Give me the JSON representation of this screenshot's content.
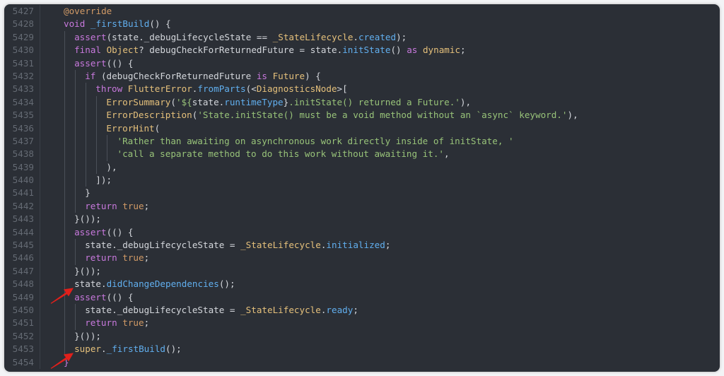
{
  "editor": {
    "lines": [
      {
        "num": "5427",
        "indent": 0,
        "tokens": [
          {
            "t": "@override",
            "c": "a"
          }
        ]
      },
      {
        "num": "5428",
        "indent": 0,
        "tokens": [
          {
            "t": "void ",
            "c": "k"
          },
          {
            "t": "_firstBuild",
            "c": "f"
          },
          {
            "t": "() {",
            "c": "p"
          }
        ]
      },
      {
        "num": "5429",
        "indent": 1,
        "tokens": [
          {
            "t": "assert",
            "c": "k"
          },
          {
            "t": "(state.",
            "c": "p"
          },
          {
            "t": "_debugLifecycleState",
            "c": "p"
          },
          {
            "t": " == ",
            "c": "p"
          },
          {
            "t": "_StateLifecycle",
            "c": "y"
          },
          {
            "t": ".",
            "c": "p"
          },
          {
            "t": "created",
            "c": "f"
          },
          {
            "t": ");",
            "c": "p"
          }
        ]
      },
      {
        "num": "5430",
        "indent": 1,
        "tokens": [
          {
            "t": "final ",
            "c": "k"
          },
          {
            "t": "Object",
            "c": "y"
          },
          {
            "t": "? debugCheckForReturnedFuture = state.",
            "c": "p"
          },
          {
            "t": "initState",
            "c": "f"
          },
          {
            "t": "() ",
            "c": "p"
          },
          {
            "t": "as ",
            "c": "k"
          },
          {
            "t": "dynamic",
            "c": "y"
          },
          {
            "t": ";",
            "c": "p"
          }
        ]
      },
      {
        "num": "5431",
        "indent": 1,
        "tokens": [
          {
            "t": "assert",
            "c": "k"
          },
          {
            "t": "(() {",
            "c": "p"
          }
        ]
      },
      {
        "num": "5432",
        "indent": 2,
        "tokens": [
          {
            "t": "if ",
            "c": "k"
          },
          {
            "t": "(debugCheckForReturnedFuture ",
            "c": "p"
          },
          {
            "t": "is ",
            "c": "k"
          },
          {
            "t": "Future",
            "c": "y"
          },
          {
            "t": ") {",
            "c": "p"
          }
        ]
      },
      {
        "num": "5433",
        "indent": 3,
        "tokens": [
          {
            "t": "throw ",
            "c": "k"
          },
          {
            "t": "FlutterError",
            "c": "y"
          },
          {
            "t": ".",
            "c": "p"
          },
          {
            "t": "fromParts",
            "c": "f"
          },
          {
            "t": "(<",
            "c": "p"
          },
          {
            "t": "DiagnosticsNode",
            "c": "y"
          },
          {
            "t": ">[",
            "c": "p"
          }
        ]
      },
      {
        "num": "5434",
        "indent": 4,
        "tokens": [
          {
            "t": "ErrorSummary",
            "c": "y"
          },
          {
            "t": "(",
            "c": "p"
          },
          {
            "t": "'${",
            "c": "s"
          },
          {
            "t": "state.",
            "c": "p"
          },
          {
            "t": "runtimeType",
            "c": "f"
          },
          {
            "t": "}",
            "c": "p"
          },
          {
            "t": ".initState() returned a Future.'",
            "c": "s"
          },
          {
            "t": "),",
            "c": "p"
          }
        ]
      },
      {
        "num": "5435",
        "indent": 4,
        "tokens": [
          {
            "t": "ErrorDescription",
            "c": "y"
          },
          {
            "t": "(",
            "c": "p"
          },
          {
            "t": "'State.initState() must be a void method without an `async` keyword.'",
            "c": "s"
          },
          {
            "t": "),",
            "c": "p"
          }
        ]
      },
      {
        "num": "5436",
        "indent": 4,
        "tokens": [
          {
            "t": "ErrorHint",
            "c": "y"
          },
          {
            "t": "(",
            "c": "p"
          }
        ]
      },
      {
        "num": "5437",
        "indent": 5,
        "tokens": [
          {
            "t": "'Rather than awaiting on asynchronous work directly inside of initState, '",
            "c": "s"
          }
        ]
      },
      {
        "num": "5438",
        "indent": 5,
        "tokens": [
          {
            "t": "'call a separate method to do this work without awaiting it.'",
            "c": "s"
          },
          {
            "t": ",",
            "c": "p"
          }
        ]
      },
      {
        "num": "5439",
        "indent": 4,
        "tokens": [
          {
            "t": "),",
            "c": "p"
          }
        ]
      },
      {
        "num": "5440",
        "indent": 3,
        "tokens": [
          {
            "t": "]);",
            "c": "p"
          }
        ]
      },
      {
        "num": "5441",
        "indent": 2,
        "tokens": [
          {
            "t": "}",
            "c": "p"
          }
        ]
      },
      {
        "num": "5442",
        "indent": 2,
        "tokens": [
          {
            "t": "return ",
            "c": "k"
          },
          {
            "t": "true",
            "c": "a"
          },
          {
            "t": ";",
            "c": "p"
          }
        ]
      },
      {
        "num": "5443",
        "indent": 1,
        "tokens": [
          {
            "t": "}());",
            "c": "p"
          }
        ]
      },
      {
        "num": "5444",
        "indent": 1,
        "tokens": [
          {
            "t": "assert",
            "c": "k"
          },
          {
            "t": "(() {",
            "c": "p"
          }
        ]
      },
      {
        "num": "5445",
        "indent": 2,
        "tokens": [
          {
            "t": "state.",
            "c": "p"
          },
          {
            "t": "_debugLifecycleState",
            "c": "p"
          },
          {
            "t": " = ",
            "c": "p"
          },
          {
            "t": "_StateLifecycle",
            "c": "y"
          },
          {
            "t": ".",
            "c": "p"
          },
          {
            "t": "initialized",
            "c": "f"
          },
          {
            "t": ";",
            "c": "p"
          }
        ]
      },
      {
        "num": "5446",
        "indent": 2,
        "tokens": [
          {
            "t": "return ",
            "c": "k"
          },
          {
            "t": "true",
            "c": "a"
          },
          {
            "t": ";",
            "c": "p"
          }
        ]
      },
      {
        "num": "5447",
        "indent": 1,
        "tokens": [
          {
            "t": "}());",
            "c": "p"
          }
        ]
      },
      {
        "num": "5448",
        "indent": 1,
        "tokens": [
          {
            "t": "state.",
            "c": "p"
          },
          {
            "t": "didChangeDependencies",
            "c": "f"
          },
          {
            "t": "();",
            "c": "p"
          }
        ]
      },
      {
        "num": "5449",
        "indent": 1,
        "tokens": [
          {
            "t": "assert",
            "c": "k"
          },
          {
            "t": "(() {",
            "c": "p"
          }
        ]
      },
      {
        "num": "5450",
        "indent": 2,
        "tokens": [
          {
            "t": "state.",
            "c": "p"
          },
          {
            "t": "_debugLifecycleState",
            "c": "p"
          },
          {
            "t": " = ",
            "c": "p"
          },
          {
            "t": "_StateLifecycle",
            "c": "y"
          },
          {
            "t": ".",
            "c": "p"
          },
          {
            "t": "ready",
            "c": "f"
          },
          {
            "t": ";",
            "c": "p"
          }
        ]
      },
      {
        "num": "5451",
        "indent": 2,
        "tokens": [
          {
            "t": "return ",
            "c": "k"
          },
          {
            "t": "true",
            "c": "a"
          },
          {
            "t": ";",
            "c": "p"
          }
        ]
      },
      {
        "num": "5452",
        "indent": 1,
        "tokens": [
          {
            "t": "}());",
            "c": "p"
          }
        ]
      },
      {
        "num": "5453",
        "indent": 1,
        "tokens": [
          {
            "t": "super",
            "c": "y"
          },
          {
            "t": ".",
            "c": "p"
          },
          {
            "t": "_firstBuild",
            "c": "f"
          },
          {
            "t": "();",
            "c": "p"
          }
        ]
      },
      {
        "num": "5454",
        "indent": 0,
        "tokens": [
          {
            "t": "}",
            "c": "k"
          }
        ]
      }
    ]
  },
  "annotations": {
    "arrow_color": "#e0201b",
    "arrows": [
      {
        "name": "arrow-didChangeDependencies-icon",
        "line": "5448"
      },
      {
        "name": "arrow-super-firstBuild-icon",
        "line": "5453"
      }
    ]
  },
  "theme": {
    "background": "#2b2f36",
    "keyword": "#c879dd",
    "type": "#e5c07b",
    "function": "#61afef",
    "string": "#98c379",
    "plain": "#d4d7dc",
    "annotation": "#d19a66",
    "line_number": "#646a73"
  }
}
